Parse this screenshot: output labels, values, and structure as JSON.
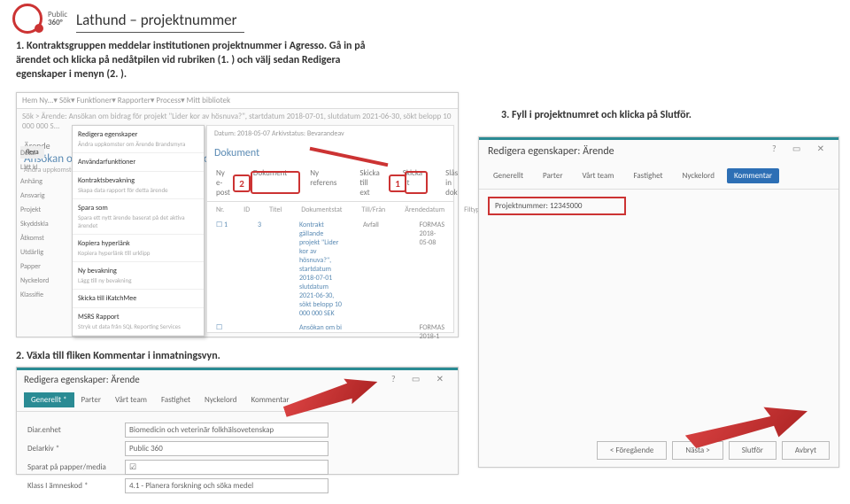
{
  "logo": {
    "brand": "Public",
    "product": "360°"
  },
  "title": "Lathund – projektnummer",
  "step1": "1. Kontraktsgruppen meddelar institutionen projektnummer i Agresso. Gå in på ärendet och klicka på nedåtpilen vid rubriken (1. ) och välj sedan Redigera egenskaper i menyn (2. ).",
  "step2": "2. Växla till fliken Kommentar i inmatningsvyn.",
  "step3": "3. Fyll i projektnumret och klicka på Slutför.",
  "shot1": {
    "navTabs": "Hem    Ny...▾    Sök▾    Funktioner▾    Rapporter▾    Process▾    Mitt bibliotek",
    "breadcrumb": "Sök > Ärende: Ansökan om bidrag för projekt \"Lider kor av hösnuva?\", startdatum 2018-07-01, slutdatum 2021-06-30, sökt belopp 10 000 000 S...",
    "caseHdr": "Ärende",
    "caseTitle": "Ansökan om bidrag för projekt \"Lider kor av hösnuva?\", startdatum 201...",
    "caseSub": "Ändra uppkomster om Ärende Brandsmyra",
    "leftLabels": [
      "Detal",
      "Lätt kl",
      "Anhäng",
      "Ansvarig",
      "Projekt",
      "Skyddskla",
      "Åtkomst",
      "Utdärlig",
      "Papper",
      "Nyckelord",
      "Klassifie"
    ],
    "flera": "flera",
    "menu": [
      {
        "t": "Redigera egenskaper",
        "s": "Ändra uppkomster om Ärende Brandsmyra"
      },
      {
        "t": "Användarfunktioner",
        "s": ""
      },
      {
        "t": "Kontraktsbevakning",
        "s": "Skapa data rapport för detta ärende"
      },
      {
        "t": "Spara som",
        "s": "Spara ett nytt ärende baserat på det aktiva ärendet"
      },
      {
        "t": "Kopiera hyperlänk",
        "s": "Kopiera hyperlänk till urklipp"
      },
      {
        "t": "Ny bevakning",
        "s": "Lägg till ny bevakning"
      },
      {
        "t": "Skicka till iKatchMee",
        "s": ""
      },
      {
        "t": "MSRS Rapport",
        "s": "Stryk ut data från SQL Reporting Services"
      }
    ],
    "docHdr": "Dokument",
    "docMeta": "Datum: 2018-05-07   Arkivstatus: Bevarandeav",
    "docTabs": [
      "Ny e-post",
      "Dokument",
      "Ny referens",
      "Skicka till ext",
      "Skicka ut",
      "Slås in dok"
    ],
    "tblHdr": [
      "Nr.",
      "ID",
      "Titel",
      "Dokumentstat",
      "Till/Från",
      "Ärendedatum",
      "Filtyp(er)"
    ],
    "rows": [
      {
        "nr": "1",
        "id": "3",
        "titel": "Kontrakt gällande projekt \"Lider kor av hösnuva?\", startdatum 2018-07-01 slutdatum 2021-06-30, sökt belopp 10 000 000 SEK",
        "stat": "Avfall",
        "fran": "",
        "dat": "FORMAS  2018-05-08"
      },
      {
        "nr": "",
        "id": "",
        "titel": "Ansökan om bi",
        "stat": "",
        "fran": "",
        "dat": "FORMAS  2018-1"
      }
    ],
    "num1": "1",
    "num2": "2"
  },
  "shot2": {
    "title": "Redigera egenskaper: Ärende",
    "tabs": [
      "Generellt *",
      "Parter",
      "Vårt team",
      "Fastighet",
      "Nyckelord",
      "Kommentar"
    ],
    "fields": [
      {
        "l": "Diar.enhet",
        "v": "Biomedicin och veterinär folkhälsovetenskap"
      },
      {
        "l": "Delarkiv *",
        "v": "Public 360"
      },
      {
        "l": "Sparat på papper/media",
        "v": "☑"
      },
      {
        "l": "Klass I ämneskod *",
        "v": "4.1 - Planera forskning och söka medel"
      }
    ]
  },
  "shot3": {
    "title": "Redigera egenskaper: Ärende",
    "tabs": [
      "Generellt",
      "Parter",
      "Vårt team",
      "Fastighet",
      "Nyckelord",
      "Kommentar"
    ],
    "field": {
      "l": "Projektnummer:",
      "v": "12345000"
    },
    "buttons": [
      "< Föregående",
      "Nästa >",
      "Slutför",
      "Avbryt"
    ],
    "icons": "?  ▭  ✕"
  }
}
